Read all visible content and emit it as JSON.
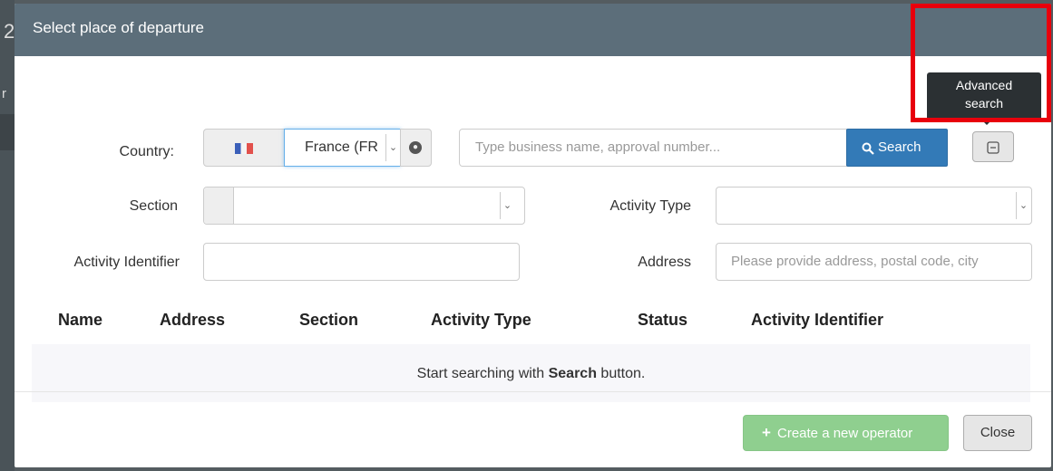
{
  "background": {
    "fragment_a": "2",
    "fragment_b": "r"
  },
  "modal": {
    "title": "Select place of departure"
  },
  "form": {
    "country_label": "Country:",
    "country_value": "France (FR",
    "search_placeholder": "Type business name, approval number...",
    "search_button_label": "Search",
    "advanced_search_tooltip_line1": "Advanced",
    "advanced_search_tooltip_line2": "search",
    "section_label": "Section",
    "activity_type_label": "Activity Type",
    "activity_identifier_label": "Activity Identifier",
    "address_label": "Address",
    "address_placeholder": "Please provide address, postal code, city"
  },
  "table": {
    "columns": [
      "Name",
      "Address",
      "Section",
      "Activity Type",
      "Status",
      "Activity Identifier"
    ],
    "empty_prefix": "Start searching with ",
    "empty_bold": "Search",
    "empty_suffix": " button."
  },
  "footer": {
    "create_label": "Create a new operator",
    "close_label": "Close"
  },
  "colors": {
    "header": "#5c6e7a",
    "primary": "#337ab7",
    "success_disabled": "#8fcf8f",
    "highlight": "#e8000c"
  }
}
